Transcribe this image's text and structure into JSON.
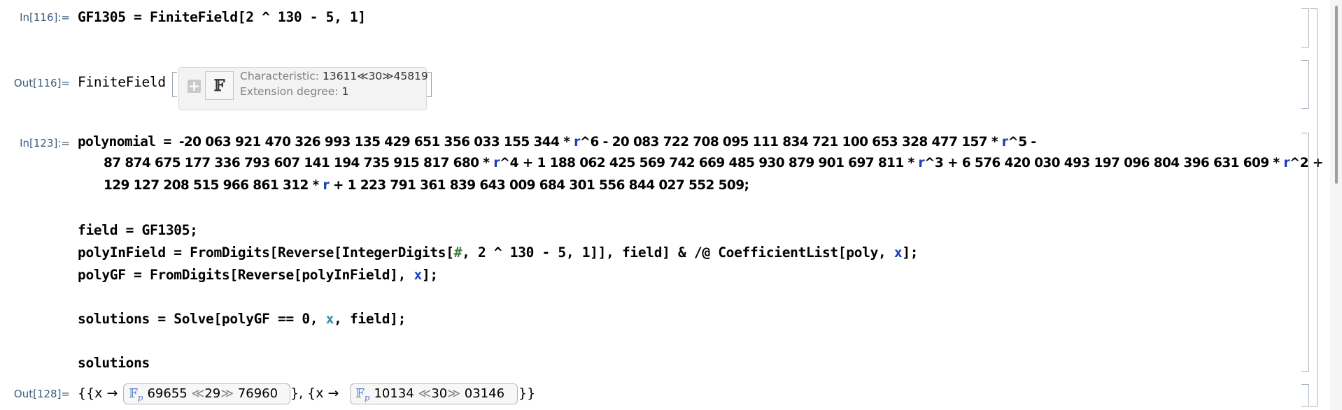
{
  "cells": {
    "in116": {
      "label": "In[116]:=",
      "code": "GF1305 = FiniteField[2 ^ 130 - 5, 1]"
    },
    "out116": {
      "label": "Out[116]=",
      "head": "FiniteField",
      "summary": {
        "characteristic_label": "Characteristic:",
        "characteristic_value": "13611≪30≫45819",
        "degree_label": "Extension degree:",
        "degree_value": "1",
        "icon_glyph": "𝔽"
      }
    },
    "in123": {
      "label": "In[123]:=",
      "poly_line1": [
        "polynomial = ",
        "-20 063 921 470 326 993 135 429 651 356 033 155 344 ",
        "*",
        " r",
        "^6 - 20 083 722 708 095 111 834 721 100 653 328 477 157 ",
        "*",
        " r",
        "^5 -"
      ],
      "poly_line2": [
        "87 874 675 177 336 793 607 141 194 735 915 817 680 ",
        "*",
        " r",
        "^4 + 1 188 062 425 569 742 669 485 930 879 901 697 811 ",
        "*",
        " r",
        "^3 + 6 576 420 030 493 197 096 804 396 631 609 ",
        "*",
        " r",
        "^2 +"
      ],
      "poly_line3": [
        "129 127 208 515 966 861 312 ",
        "*",
        " r",
        " + 1 223 791 361 839 643 009 684 301 556 844 027 552 509;"
      ],
      "field_line": "field = GF1305;",
      "polyinfield_a": "polyInField = FromDigits[Reverse[IntegerDigits[",
      "polyinfield_slot": "#",
      "polyinfield_b": ", 2 ^ 130 - 5, 1]], field] & /@ CoefficientList[poly, ",
      "polyinfield_var": "x",
      "polyinfield_c": "];",
      "polygf_a": "polyGF = FromDigits[Reverse[polyInField], ",
      "polygf_var": "x",
      "polygf_b": "];",
      "solutions_a": "solutions = Solve[polyGF == 0, ",
      "solutions_var": "x",
      "solutions_b": ", field];",
      "solutions_line": "solutions"
    },
    "out128": {
      "label": "Out[128]=",
      "open": "{{x → ",
      "mid": "}, {x → ",
      "close": "}}",
      "fp_glyph": "𝔽",
      "fp_sub": "p",
      "elem1": {
        "head": "69655",
        "middle": "29",
        "tail": "76960"
      },
      "elem2": {
        "head": "10134",
        "middle": "30",
        "tail": "03146"
      }
    }
  }
}
